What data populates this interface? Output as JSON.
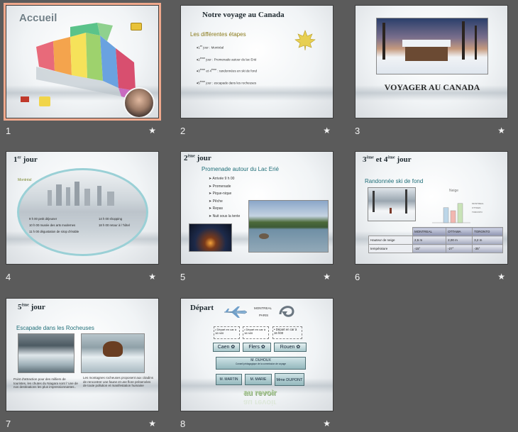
{
  "slides": [
    {
      "number": "1",
      "title": "Accueil"
    },
    {
      "number": "2",
      "title": "Notre voyage au Canada",
      "subtitle": "Les différentes étapes",
      "bullets": [
        {
          "main": "1",
          "sup": "er",
          "rest": " jour : Montréal"
        },
        {
          "main": "2",
          "sup": "ème",
          "rest": " jour : Promenade autour du lac Erié"
        },
        {
          "main": "3",
          "sup": "ème",
          "mid": " et 4",
          "sup2": "ème",
          "rest": " : randonnées en ski de fond"
        },
        {
          "main": "5",
          "sup": "ème",
          "rest": " jour : escapade dans les rocheuses"
        }
      ]
    },
    {
      "number": "3",
      "title": "VOYAGER AU CANADA"
    },
    {
      "number": "4",
      "title_main": "1",
      "title_sup": "er",
      "title_rest": " jour",
      "city": "Montréal",
      "schedule_left": [
        "9 h 00 petit déjeuner",
        "10 h 00 musée des arts modernes",
        "11 h 00 dégustation de sirop d'érable"
      ],
      "schedule_right": [
        "14 h 00 shopping",
        "18 h 00 retour à l 'hôtel"
      ]
    },
    {
      "number": "5",
      "title_main": "2",
      "title_sup": "ème",
      "title_rest": " jour",
      "subtitle": "Promenade autour du Lac Erié",
      "bullets": [
        "Arrivée 9 h 00",
        "Promenade",
        "Pique-nique",
        "Pêche",
        "Repas",
        "Nuit sous la tente"
      ]
    },
    {
      "number": "6",
      "title_a": "3",
      "sup_a": "ème",
      "title_mid": " et 4",
      "sup_b": "ème",
      "title_rest": " jour",
      "subtitle": "Randonnée ski de fond",
      "chart_title": "Neige",
      "table": {
        "headers": [
          "",
          "MONTREAL",
          "OTTAWA",
          "TORONTO"
        ],
        "rows": [
          [
            "Hauteur de neige",
            "2,5 m",
            "2,00 m",
            "3,2 m"
          ],
          [
            "température",
            "-15°",
            "-27°",
            "-35°"
          ]
        ]
      }
    },
    {
      "number": "7",
      "title_main": "5",
      "title_sup": "ème",
      "title_rest": " jour",
      "subtitle": "Escapade dans les Rocheuses",
      "text_left": "Point d'attraction pour des milliers de touristes, les chutes du Niagara sont l 'une de nos destinations les plus impressionnantes..",
      "text_right": "Les montagnes rocheuses proposent aux citadins de rencontrer une faune et une flore préservées de toute pollution et manifestation humaine"
    },
    {
      "number": "8",
      "title": "Départ",
      "from_label": "MONTREAL",
      "to_label": "PARIS",
      "departures": [
        "Départ en car à 16 h00",
        "Départ en car à 16 h00",
        "Départ en car à 16 h00"
      ],
      "cities": [
        "Caen",
        "Flers",
        "Rouen"
      ],
      "org_top": "M. DUHOUX",
      "org_top_sub": "Conseil pédagogique de la commission de voyage",
      "org_bottom": [
        "M. MARTIN",
        "M. MARIE",
        "Mme DUPONT"
      ],
      "goodbye": "au revoir"
    }
  ],
  "star_glyph": "★",
  "colors": {
    "background": "#5b5b5b",
    "selected_outline": "#f0a98d",
    "title_teal": "#1f6e78",
    "subtitle_olive": "#8a7a1a"
  },
  "chart_data": {
    "type": "bar",
    "title": "Neige",
    "categories": [
      "Neige",
      "Hauteur de neige",
      "température"
    ],
    "series": [
      {
        "name": "MONTREAL",
        "values": [
          2.5
        ]
      },
      {
        "name": "OTTAWA",
        "values": [
          2.0
        ]
      },
      {
        "name": "TORONTO",
        "values": [
          3.2
        ]
      }
    ]
  }
}
